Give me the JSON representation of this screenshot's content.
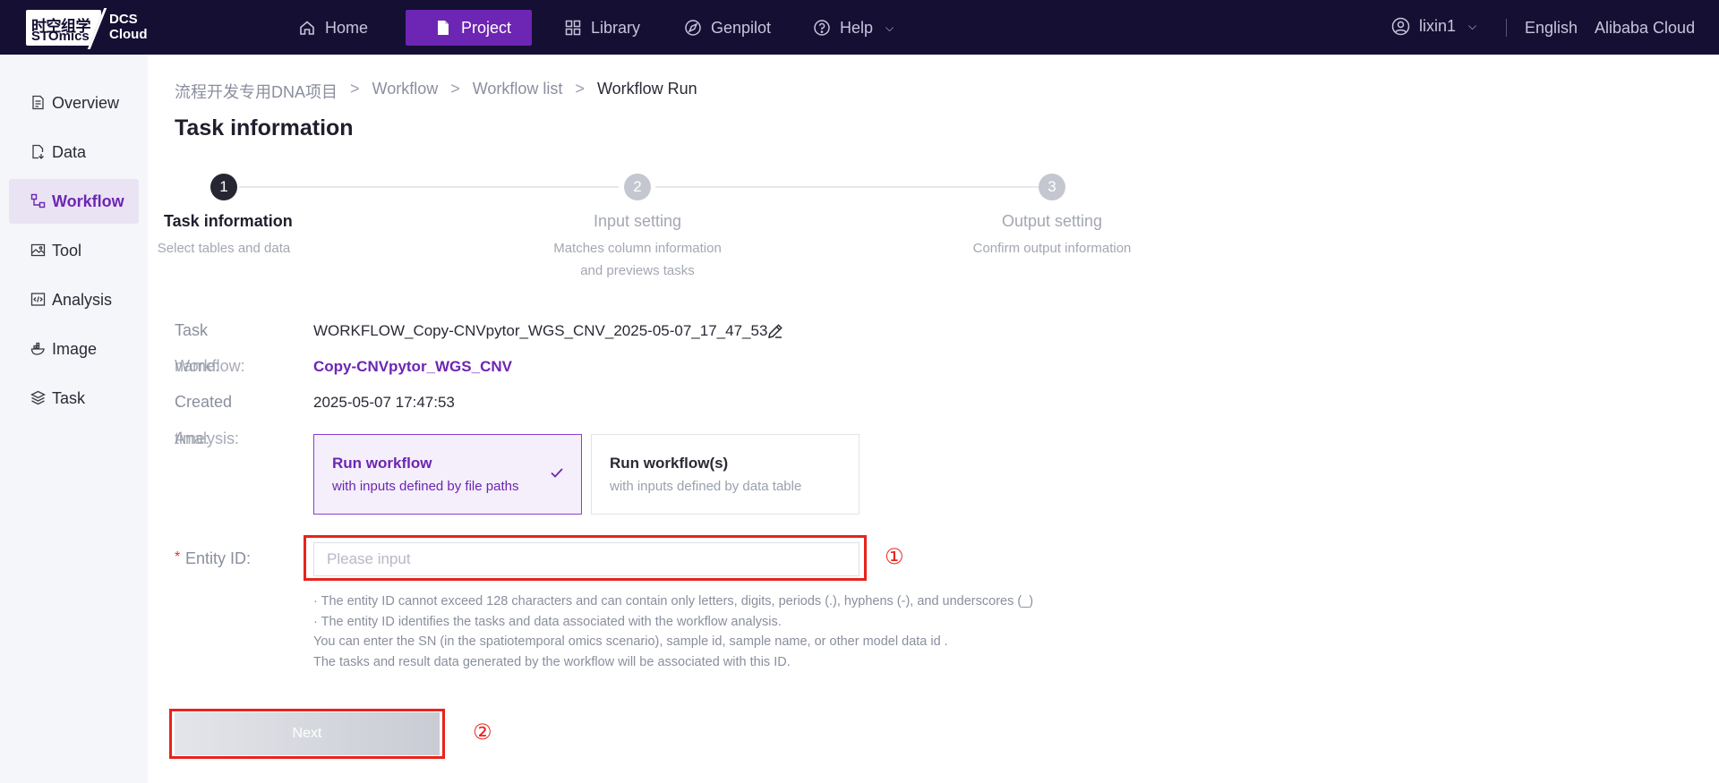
{
  "brand": {
    "logo_cn": "时空组学",
    "logo_en": "STOmics",
    "logo_right_1": "DCS",
    "logo_right_2": "Cloud"
  },
  "nav": [
    {
      "label": "Home",
      "icon": "home-icon"
    },
    {
      "label": "Project",
      "icon": "document-icon",
      "active": true
    },
    {
      "label": "Library",
      "icon": "grid-icon"
    },
    {
      "label": "Genpilot",
      "icon": "compass-icon"
    },
    {
      "label": "Help",
      "icon": "help-circle-icon"
    }
  ],
  "header": {
    "username": "lixin1",
    "language": "English",
    "cloud": "Alibaba Cloud"
  },
  "sidebar": {
    "items": [
      {
        "label": "Overview",
        "icon": "overview-icon"
      },
      {
        "label": "Data",
        "icon": "data-file-icon"
      },
      {
        "label": "Workflow",
        "icon": "workflow-icon",
        "active": true
      },
      {
        "label": "Tool",
        "icon": "tool-image-icon"
      },
      {
        "label": "Analysis",
        "icon": "analysis-code-icon"
      },
      {
        "label": "Image",
        "icon": "docker-whale-icon"
      },
      {
        "label": "Task",
        "icon": "layers-icon"
      }
    ]
  },
  "breadcrumb": [
    "流程开发专用DNA项目",
    "Workflow",
    "Workflow list",
    "Workflow Run"
  ],
  "page_title": "Task information",
  "steps": [
    {
      "num": "1",
      "title": "Task information",
      "desc_1": "Select tables and data",
      "desc_2": ""
    },
    {
      "num": "2",
      "title": "Input setting",
      "desc_1": "Matches column information",
      "desc_2": "and previews tasks"
    },
    {
      "num": "3",
      "title": "Output setting",
      "desc_1": "Confirm output information",
      "desc_2": ""
    }
  ],
  "form": {
    "task_name_label_1": "Task",
    "task_name_label_2": "name:",
    "task_name_value": "WORKFLOW_Copy-CNVpytor_WGS_CNV_2025-05-07_17_47_53",
    "workflow_label": "Workflow:",
    "workflow_value": "Copy-CNVpytor_WGS_CNV",
    "created_label_1": "Created",
    "created_label_2": "time:",
    "created_value": "2025-05-07 17:47:53",
    "analysis_label": "Analysis:",
    "options": [
      {
        "title": "Run workflow",
        "sub": "with inputs defined by file paths",
        "selected": true
      },
      {
        "title": "Run workflow(s)",
        "sub": "with inputs defined by data table",
        "selected": false
      }
    ],
    "entity_required": "*",
    "entity_label": "Entity  ID:",
    "entity_value": "",
    "entity_placeholder": "Please input",
    "hints": [
      "· The entity ID cannot exceed 128 characters and can contain only letters, digits, periods (.), hyphens (-), and underscores (_)",
      "· The entity ID identifies the tasks and data associated with the workflow analysis.",
      "You can enter the SN (in the spatiotemporal omics scenario), sample id, sample name, or other model data id .",
      "The tasks and result data generated by the workflow will be associated with this ID."
    ],
    "next_label": "Next"
  },
  "annotations": {
    "marker_1": "①",
    "marker_2": "②",
    "color": "#e8231c"
  },
  "colors": {
    "topbar": "#150f33",
    "accent": "#6d25b3",
    "sidebar_bg": "#f5f6f9"
  }
}
